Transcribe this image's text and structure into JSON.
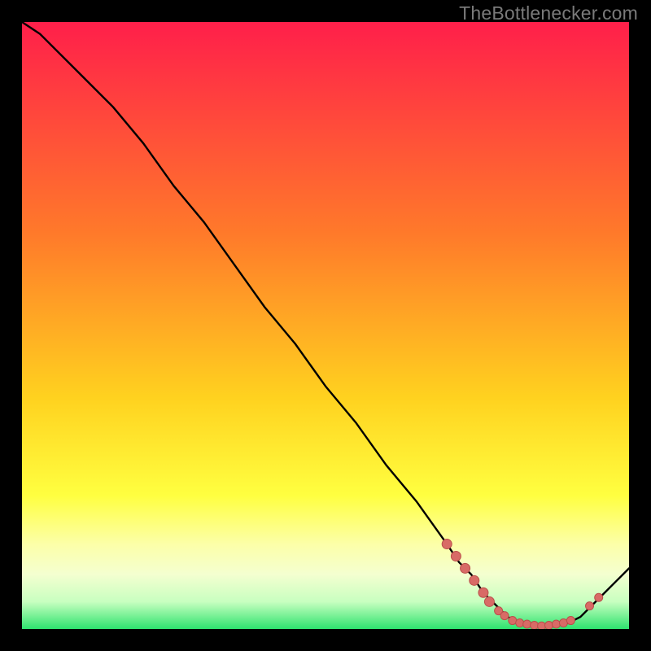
{
  "watermark": "TheBottlenecker.com",
  "colors": {
    "bg": "#000000",
    "grad_top": "#ff1f4a",
    "grad_mid1": "#ff6a2a",
    "grad_mid2": "#ffcc22",
    "grad_mid3": "#ffff55",
    "grad_mid4": "#f7ffb0",
    "grad_bot": "#2ee36e",
    "curve": "#000000",
    "marker_fill": "#d86b66",
    "marker_stroke": "#ba4f4a"
  },
  "chart_data": {
    "type": "line",
    "title": "",
    "xlabel": "",
    "ylabel": "",
    "xlim": [
      0,
      100
    ],
    "ylim": [
      0,
      100
    ],
    "series": [
      {
        "name": "bottleneck-curve",
        "x": [
          0,
          3,
          6,
          10,
          15,
          20,
          25,
          30,
          35,
          40,
          45,
          50,
          55,
          60,
          65,
          70,
          72,
          74,
          76,
          78,
          80,
          82,
          84,
          86,
          88,
          90,
          92,
          94,
          96,
          98,
          100
        ],
        "y": [
          100,
          98,
          95,
          91,
          86,
          80,
          73,
          67,
          60,
          53,
          47,
          40,
          34,
          27,
          21,
          14,
          11,
          9,
          6,
          4,
          2,
          1,
          0.6,
          0.5,
          0.6,
          1,
          2,
          4,
          6,
          8,
          10
        ]
      }
    ],
    "markers": {
      "name": "sample-points",
      "points": [
        {
          "x": 70.0,
          "y": 14.0,
          "r": 6
        },
        {
          "x": 71.5,
          "y": 12.0,
          "r": 6
        },
        {
          "x": 73.0,
          "y": 10.0,
          "r": 6
        },
        {
          "x": 74.5,
          "y": 8.0,
          "r": 6
        },
        {
          "x": 76.0,
          "y": 6.0,
          "r": 6
        },
        {
          "x": 77.0,
          "y": 4.5,
          "r": 6
        },
        {
          "x": 78.5,
          "y": 3.0,
          "r": 5
        },
        {
          "x": 79.5,
          "y": 2.2,
          "r": 5
        },
        {
          "x": 80.8,
          "y": 1.4,
          "r": 5
        },
        {
          "x": 82.0,
          "y": 1.0,
          "r": 5
        },
        {
          "x": 83.2,
          "y": 0.8,
          "r": 5
        },
        {
          "x": 84.4,
          "y": 0.6,
          "r": 5
        },
        {
          "x": 85.6,
          "y": 0.5,
          "r": 5
        },
        {
          "x": 86.8,
          "y": 0.6,
          "r": 5
        },
        {
          "x": 88.0,
          "y": 0.8,
          "r": 5
        },
        {
          "x": 89.2,
          "y": 1.0,
          "r": 5
        },
        {
          "x": 90.4,
          "y": 1.4,
          "r": 5
        },
        {
          "x": 93.5,
          "y": 3.8,
          "r": 5
        },
        {
          "x": 95.0,
          "y": 5.2,
          "r": 5
        }
      ]
    }
  }
}
